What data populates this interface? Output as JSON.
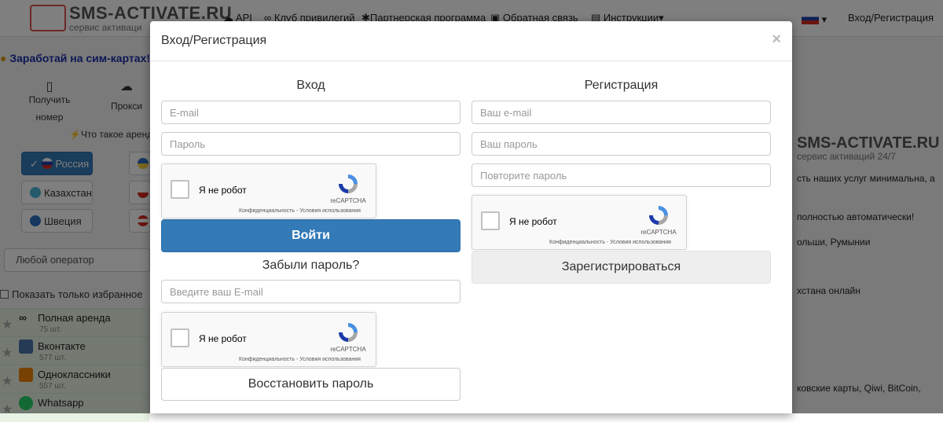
{
  "site": {
    "logo": "SMS-ACTIVATE.RU",
    "logo_sub": "сервис активаци",
    "nav": [
      "API",
      "Клуб привилегий",
      "Партнерская программа",
      "Обратная связь",
      "Инструкции"
    ],
    "login_link": "Вход/Регистрация",
    "banner": "Заработай на сим-картах! П",
    "tabs": [
      {
        "line1": "Получить",
        "line2": "номер"
      },
      {
        "label": "Прокси"
      }
    ],
    "rent_hint": "Что такое аренда",
    "countries": [
      "Россия",
      "Казахстан",
      "Швеция"
    ],
    "operator": "Любой оператор",
    "favorites_label": "Показать только избранное",
    "services": [
      {
        "name": "Полная аренда",
        "count": "75 шт."
      },
      {
        "name": "Вконтакте",
        "count": "577 шт."
      },
      {
        "name": "Одноклассники",
        "count": "557 шт."
      },
      {
        "name": "Whatsapp",
        "count": ""
      }
    ],
    "right_logo": "SMS-ACTIVATE.RU",
    "right_logo_sub": "сервис активаций 24/7",
    "right_lines": [
      "сть наших услуг минимальна, а",
      "полностью автоматически!",
      "ольши, Румынии",
      "хстана онлайн",
      "ковские карты, Qiwi, BitCoin,"
    ]
  },
  "modal": {
    "title": "Вход/Регистрация",
    "close": "×",
    "login": {
      "title": "Вход",
      "email_placeholder": "E-mail",
      "password_placeholder": "Пароль",
      "submit": "Войти"
    },
    "forgot": {
      "title": "Забыли пароль?",
      "email_placeholder": "Введите ваш E-mail",
      "submit": "Восстановить пароль"
    },
    "register": {
      "title": "Регистрация",
      "email_placeholder": "Ваш e-mail",
      "password_placeholder": "Ваш пароль",
      "repeat_placeholder": "Повторите пароль",
      "submit": "Зарегистрироваться"
    },
    "captcha": {
      "label": "Я не робот",
      "brand": "reCAPTCHA",
      "links": "Конфиденциальность - Условия использования"
    }
  },
  "colors": {
    "primary": "#337ab7",
    "overlay": "rgba(0,0,0,0.5)"
  }
}
